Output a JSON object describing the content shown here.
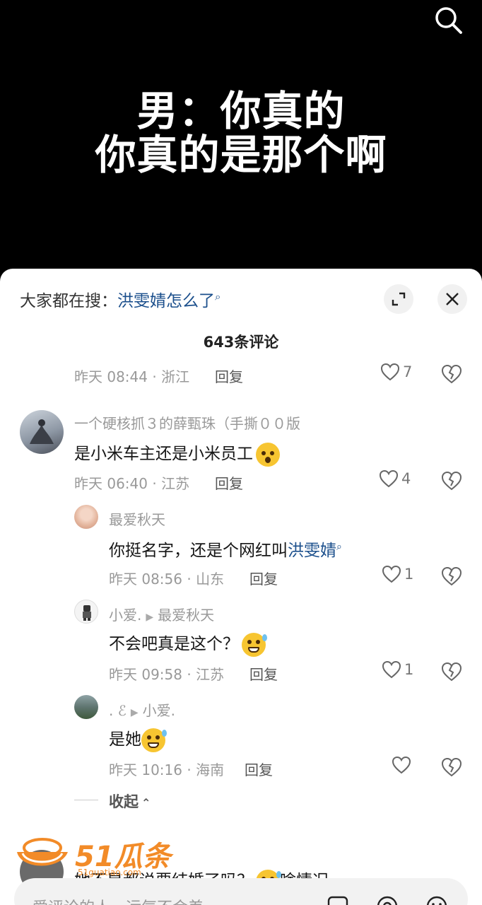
{
  "video": {
    "caption_line1": "男：你真的",
    "caption_line2": "你真的是那个啊"
  },
  "sheet": {
    "search_prefix": "大家都在搜：",
    "search_term": "洪雯婧怎么了",
    "comment_count": "643条评论"
  },
  "comments": {
    "top_partial": {
      "meta": "昨天 08:44 · 浙江",
      "reply": "回复",
      "likes": "7"
    },
    "c1": {
      "name": "一个硬核抓３的薛甄珠（手撕００版",
      "text": "是小米车主还是小米员工",
      "meta": "昨天 06:40 · 江苏",
      "reply": "回复",
      "likes": "4"
    },
    "r1": {
      "name": "最爱秋天",
      "text_prefix": "你挺名字，还是个网红叫",
      "text_link": "洪雯婧",
      "meta": "昨天 08:56 · 山东",
      "reply": "回复",
      "likes": "1"
    },
    "r2": {
      "name": "小爱.",
      "reply_to": "最爱秋天",
      "text": "不会吧真是这个？",
      "meta": "昨天 09:58 · 江苏",
      "reply": "回复",
      "likes": "1"
    },
    "r3": {
      "name": ". ℰ",
      "reply_to": "小爱.",
      "text": "是她",
      "meta": "昨天 10:16 · 海南",
      "reply": "回复"
    },
    "collapse_label": "收起",
    "next_partial": "她不是都说要结婚了吗？",
    "next_partial_tail": "啥情况"
  },
  "watermark": {
    "brand": "51瓜条",
    "domain": "51guatiao.com"
  },
  "input": {
    "placeholder": "爱评论的人，运气不会差"
  },
  "colors": {
    "link": "#1b4f8c",
    "meta": "#999999",
    "watermark": "#f28b28"
  }
}
